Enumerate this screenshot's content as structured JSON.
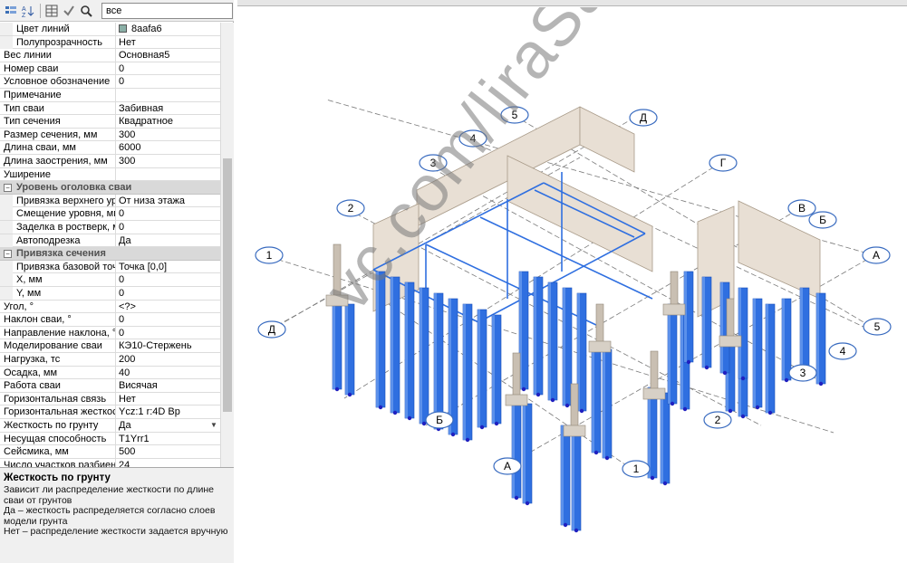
{
  "toolbar": {
    "filter_value": "все",
    "icons": [
      "categorized-icon",
      "sort-icon",
      "grid-icon",
      "check-icon",
      "search-icon"
    ]
  },
  "colors": {
    "swatch": "#8aafa6",
    "pile": "#2f6fe0",
    "pile_dark": "#1a4fb8",
    "wall": "#e8dfd4",
    "axis_marker": "#3a6cc0"
  },
  "properties": [
    {
      "name": "Цвет линий",
      "value": "8aafa6",
      "indent": true,
      "swatch": true
    },
    {
      "name": "Полупрозрачность",
      "value": "Нет",
      "indent": true
    },
    {
      "name": "Вес линии",
      "value": "Основная5"
    },
    {
      "name": "Номер сваи",
      "value": "0"
    },
    {
      "name": "Условное обозначение",
      "value": "0"
    },
    {
      "name": "Примечание",
      "value": ""
    },
    {
      "name": "Тип сваи",
      "value": "Забивная"
    },
    {
      "name": "Тип сечения",
      "value": "Квадратное"
    },
    {
      "name": "Размер сечения, мм",
      "value": "300"
    },
    {
      "name": "Длина сваи, мм",
      "value": "6000"
    },
    {
      "name": "Длина заострения, мм",
      "value": "300"
    },
    {
      "name": "Уширение",
      "value": ""
    },
    {
      "name": "Уровень оголовка сваи",
      "section": true
    },
    {
      "name": "Привязка верхнего ур...",
      "value": "От низа этажа",
      "indent": true
    },
    {
      "name": "Смещение уровня, мм",
      "value": "0",
      "indent": true
    },
    {
      "name": "Заделка в ростверк, мм",
      "value": "0",
      "indent": true
    },
    {
      "name": "Автоподрезка",
      "value": "Да",
      "indent": true
    },
    {
      "name": "Привязка сечения",
      "section": true
    },
    {
      "name": "Привязка базовой точки",
      "value": "Точка [0,0]",
      "indent": true
    },
    {
      "name": "X, мм",
      "value": "0",
      "indent": true
    },
    {
      "name": "Y, мм",
      "value": "0",
      "indent": true
    },
    {
      "name": "Угол, °",
      "value": "<?>"
    },
    {
      "name": "Наклон сваи, °",
      "value": "0"
    },
    {
      "name": "Направление наклона, °",
      "value": "0"
    },
    {
      "name": "Моделирование сваи",
      "value": "КЭ10-Стержень"
    },
    {
      "name": "Нагрузка, тс",
      "value": "200"
    },
    {
      "name": "Осадка, мм",
      "value": "40"
    },
    {
      "name": "Работа сваи",
      "value": "Висячая"
    },
    {
      "name": "Горизонтальная связь",
      "value": "Нет"
    },
    {
      "name": "Горизонтальная жесткость",
      "value": "Ycz:1  r:4D  Bp"
    },
    {
      "name": "Жесткость по грунту",
      "value": "Да",
      "selected": true,
      "dropdown": true
    },
    {
      "name": "Несущая способность",
      "value": "T1Yrr1"
    },
    {
      "name": "Сейсмика, мм",
      "value": "500"
    },
    {
      "name": "Число участков разбиения",
      "value": "24"
    }
  ],
  "help": {
    "title": "Жесткость по грунту",
    "lines": [
      "Зависит ли распределение жесткости по длине сваи от грунтов",
      "Да – жесткость распределяется согласно слоев модели грунта",
      "Нет – распределение жесткости задается вручную"
    ]
  },
  "watermark": "vc.com/liraSaprtraining",
  "axis_labels": [
    {
      "text": "1"
    },
    {
      "text": "2"
    },
    {
      "text": "3"
    },
    {
      "text": "4"
    },
    {
      "text": "5"
    },
    {
      "text": "Д"
    },
    {
      "text": "Г"
    },
    {
      "text": "В"
    },
    {
      "text": "Б"
    },
    {
      "text": "А"
    },
    {
      "text": "Д"
    },
    {
      "text": "5"
    },
    {
      "text": "4"
    },
    {
      "text": "3"
    },
    {
      "text": "2"
    },
    {
      "text": "1"
    },
    {
      "text": "Б"
    },
    {
      "text": "А"
    }
  ]
}
